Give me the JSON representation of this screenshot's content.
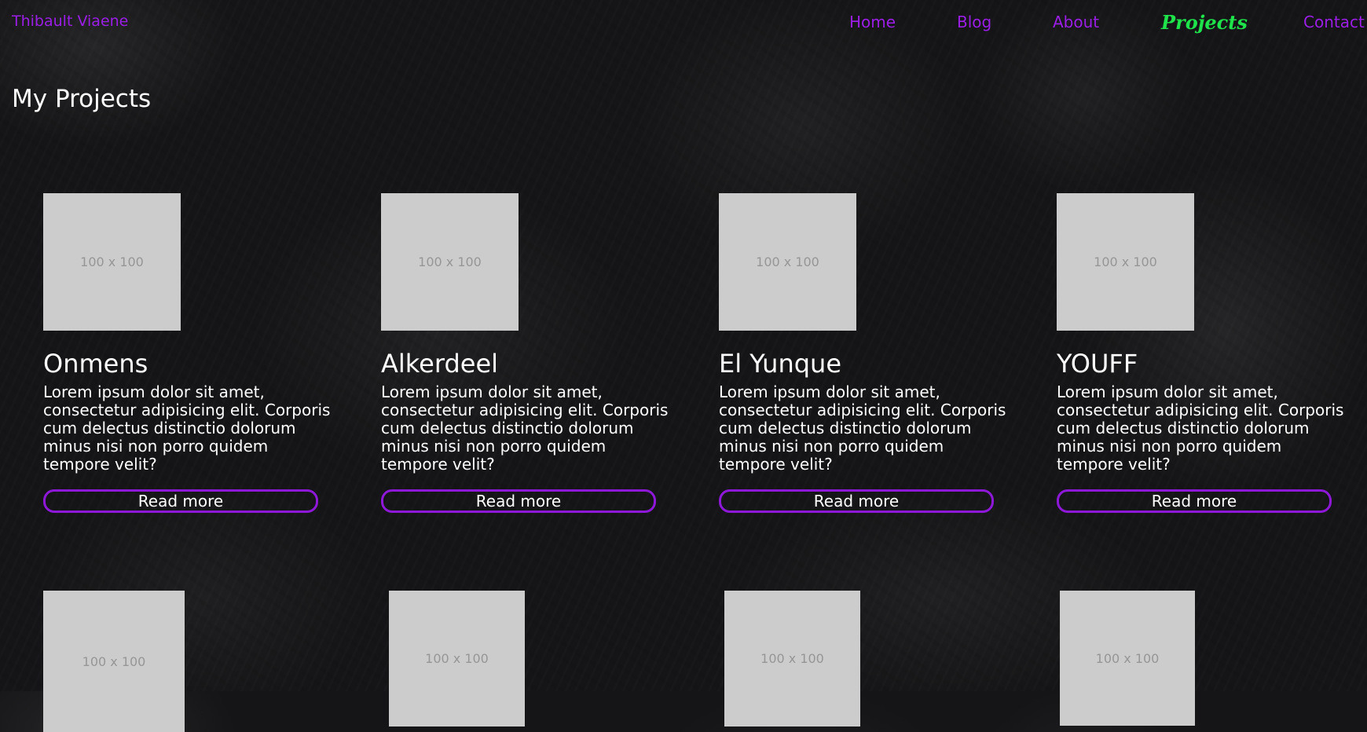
{
  "header": {
    "brand": "Thibault Viaene",
    "nav": [
      {
        "label": "Home"
      },
      {
        "label": "Blog"
      },
      {
        "label": "About"
      },
      {
        "label": "Projects"
      },
      {
        "label": "Contact"
      }
    ],
    "active_nav": "Projects"
  },
  "page": {
    "title": "My Projects"
  },
  "projects": [
    {
      "title": "Onmens",
      "thumb_text": "100 x 100",
      "description": "Lorem ipsum dolor sit amet, consectetur adipisicing elit. Corporis cum delectus distinctio dolorum minus nisi non porro quidem tempore velit?",
      "button": "Read more"
    },
    {
      "title": "Alkerdeel",
      "thumb_text": "100 x 100",
      "description": "Lorem ipsum dolor sit amet, consectetur adipisicing elit. Corporis cum delectus distinctio dolorum minus nisi non porro quidem tempore velit?",
      "button": "Read more"
    },
    {
      "title": "El Yunque",
      "thumb_text": "100 x 100",
      "description": "Lorem ipsum dolor sit amet, consectetur adipisicing elit. Corporis cum delectus distinctio dolorum minus nisi non porro quidem tempore velit?",
      "button": "Read more"
    },
    {
      "title": "YOUFF",
      "thumb_text": "100 x 100",
      "description": "Lorem ipsum dolor sit amet, consectetur adipisicing elit. Corporis cum delectus distinctio dolorum minus nisi non porro quidem tempore velit?",
      "button": "Read more"
    }
  ],
  "projects_row2": [
    {
      "thumb_text": "100 x 100"
    },
    {
      "thumb_text": "100 x 100"
    },
    {
      "thumb_text": "100 x 100"
    },
    {
      "thumb_text": "100 x 100"
    }
  ],
  "colors": {
    "accent": "#9b1ee6",
    "active_nav": "#1fe34a",
    "background": "#151517",
    "placeholder": "#cccccc"
  }
}
